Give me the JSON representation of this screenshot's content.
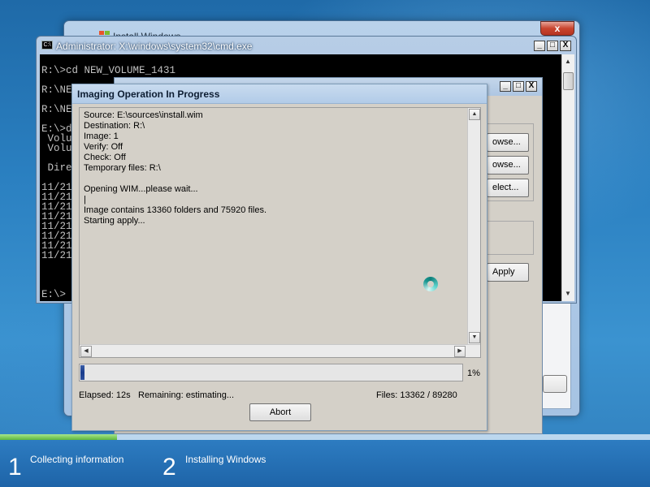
{
  "install_window": {
    "title": "Install Windows",
    "close_label": "x"
  },
  "cmd_window": {
    "title": "Administrator: X:\\windows\\system32\\cmd.exe",
    "icon_label": "C:\\",
    "minimize_label": "_",
    "maximize_label": "□",
    "close_label": "X",
    "lines": [
      "R:\\>cd NEW_VOLUME_1431",
      "R:\\NE",
      "R:\\NE",
      "E:\\>d",
      " Volu",
      " Volu",
      " Dire",
      "11/21",
      "11/21",
      "11/21",
      "11/21",
      "11/21",
      "11/21",
      "11/21",
      "11/21",
      "E:\\>"
    ]
  },
  "tool_window": {
    "minimize_label": "_",
    "maximize_label": "□",
    "close_label": "X",
    "browse1_label": "owse...",
    "browse2_label": "owse...",
    "select_label": "elect...",
    "apply_label": "Apply"
  },
  "imaging_dialog": {
    "title": "Imaging Operation In Progress",
    "log_lines": "Source: E:\\sources\\install.wim\nDestination: R:\\\nImage: 1\nVerify: Off\nCheck: Off\nTemporary files: R:\\\n\nOpening WIM...please wait...\n|\nImage contains 13360 folders and 75920 files.\nStarting apply...",
    "progress_percent": 1,
    "progress_label": "1%",
    "elapsed": "Elapsed: 12s",
    "remaining": "Remaining: estimating...",
    "files": "Files: 13362 / 89280",
    "abort_label": "Abort"
  },
  "setup_steps": {
    "progress_fraction": 0.18,
    "steps": [
      {
        "number": "1",
        "label": "Collecting information"
      },
      {
        "number": "2",
        "label": "Installing Windows"
      }
    ]
  }
}
